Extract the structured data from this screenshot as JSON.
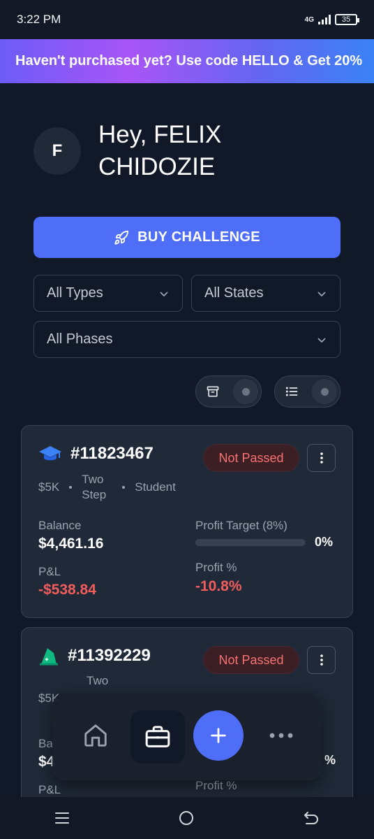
{
  "status_bar": {
    "time": "3:22 PM",
    "network": "4G",
    "battery": "35"
  },
  "promo": {
    "text": "Haven't purchased yet? Use code HELLO & Get 20%"
  },
  "greeting": {
    "initial": "F",
    "text": "Hey, FELIX CHIDOZIE"
  },
  "buy_button": {
    "label": "BUY CHALLENGE"
  },
  "filters": {
    "types": "All Types",
    "states": "All States",
    "phases": "All Phases"
  },
  "cards": [
    {
      "id": "#11823467",
      "icon": "graduation-cap-icon",
      "icon_color": "#3b82f6",
      "status": "Not Passed",
      "size": "$5K",
      "steps": "Two Step",
      "program": "Student",
      "balance_label": "Balance",
      "balance": "$4,461.16",
      "target_label": "Profit Target (8%)",
      "target_progress": 0,
      "target_value": "0%",
      "pnl_label": "P&L",
      "pnl": "-$538.84",
      "profit_pct_label": "Profit %",
      "profit_pct": "-10.8%"
    },
    {
      "id": "#11392229",
      "icon": "wizard-hat-icon",
      "icon_color": "#10b981",
      "status": "Not Passed",
      "size": "$5K",
      "steps": "Two",
      "balance_label": "Ba",
      "balance": "$4",
      "target_value": "%",
      "pnl_label": "P&L",
      "profit_pct_label": "Profit %"
    }
  ],
  "colors": {
    "accent": "#4f6ef7",
    "negative": "#f25c5c",
    "background": "#111827",
    "card": "#1f2937"
  }
}
